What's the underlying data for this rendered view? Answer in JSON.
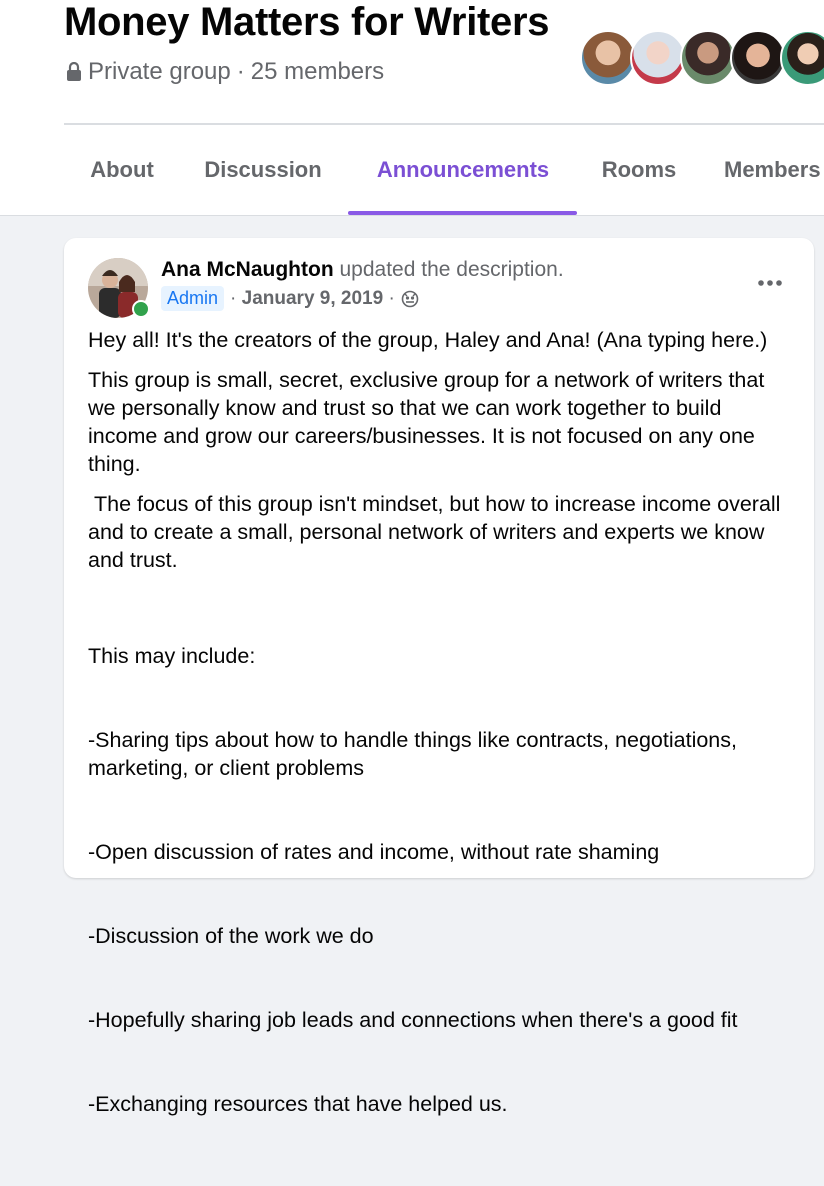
{
  "group": {
    "title": "Money Matters for Writers",
    "privacy": "Private group",
    "separator": "·",
    "members": "25 members"
  },
  "tabs": [
    {
      "label": "About"
    },
    {
      "label": "Discussion"
    },
    {
      "label": "Announcements",
      "active": true
    },
    {
      "label": "Rooms"
    },
    {
      "label": "Members"
    }
  ],
  "colors": {
    "accent": "#7b4fd4",
    "online": "#31a24c",
    "admin_badge_text": "#1877f2"
  },
  "post": {
    "author": "Ana McNaughton",
    "action": "updated the description.",
    "role": "Admin",
    "dot": "·",
    "date": "January 9, 2019",
    "audience_icon": "globe-icon",
    "more_icon": "more-horizontal-icon",
    "paragraphs": [
      "Hey all! It's the creators of the group, Haley and Ana! (Ana typing here.)",
      "This group is small, secret, exclusive group for a network of writers that we personally know and trust so that we can work together to build income and grow our careers/businesses. It is not focused on any one thing.",
      " The focus of this group isn't mindset, but how to increase income overall and to create a small, personal network of writers and experts we know and trust."
    ],
    "list_intro": "This may include:",
    "list_items": [
      "-Sharing tips about how to handle things like contracts, negotiations, marketing, or client problems",
      "-Open discussion of rates and income, without rate shaming",
      "-Discussion of the work we do",
      "-Hopefully sharing job leads and connections when there's a good fit",
      "-Exchanging resources that have helped us."
    ]
  }
}
